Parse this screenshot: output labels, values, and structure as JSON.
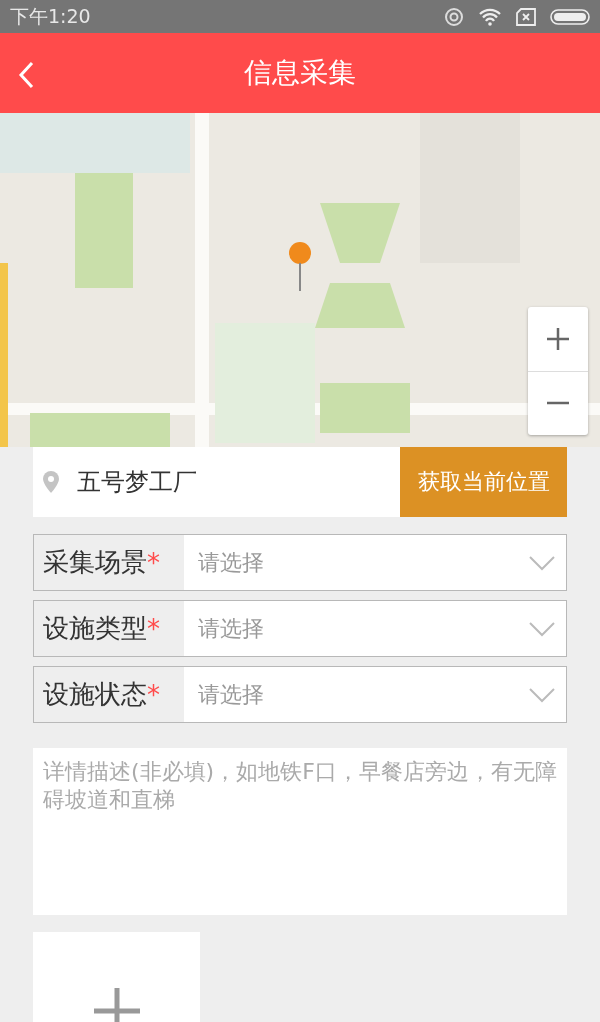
{
  "status_bar": {
    "time": "下午1:20"
  },
  "header": {
    "title": "信息采集"
  },
  "location": {
    "value": "五号梦工厂",
    "button": "获取当前位置"
  },
  "selects": [
    {
      "label": "采集场景",
      "mark": "*",
      "placeholder": "请选择"
    },
    {
      "label": "设施类型",
      "mark": "*",
      "placeholder": "请选择"
    },
    {
      "label": "设施状态",
      "mark": "*",
      "placeholder": "请选择"
    }
  ],
  "description": {
    "placeholder": "详情描述(非必填)，如地铁F口，早餐店旁边，有无障碍坡道和直梯"
  }
}
